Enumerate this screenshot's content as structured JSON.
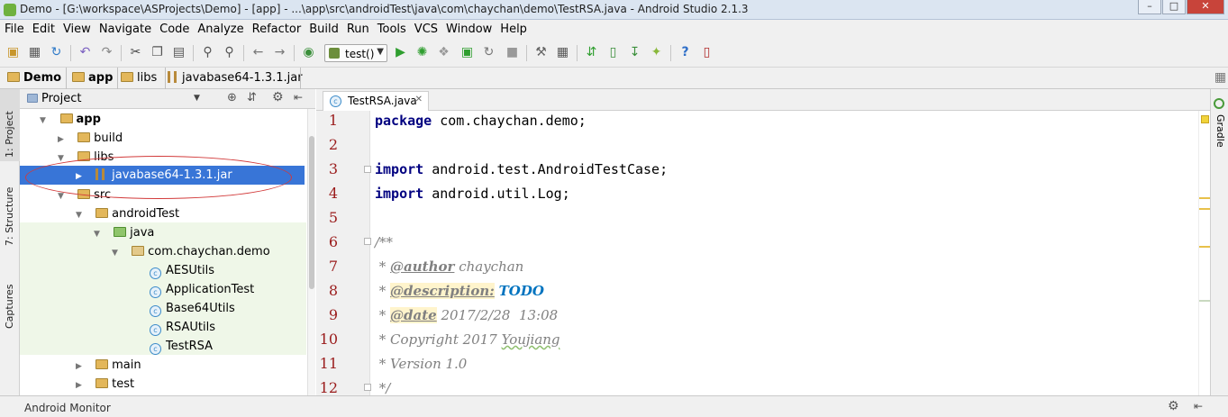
{
  "window": {
    "title": "Demo - [G:\\workspace\\ASProjects\\Demo] - [app] - ...\\app\\src\\androidTest\\java\\com\\chaychan\\demo\\TestRSA.java - Android Studio 2.1.3",
    "minimize": "–",
    "maximize": "□",
    "close": "✕"
  },
  "menu": [
    "File",
    "Edit",
    "View",
    "Navigate",
    "Code",
    "Analyze",
    "Refactor",
    "Build",
    "Run",
    "Tools",
    "VCS",
    "Window",
    "Help"
  ],
  "toolbar": {
    "run_config": "test()"
  },
  "breadcrumb": [
    "Demo",
    "app",
    "libs",
    "javabase64-1.3.1.jar"
  ],
  "left_stripe": {
    "project_tab": "1: Project",
    "structure_tab": "7: Structure",
    "captures_tab": "Captures"
  },
  "right_stripe": {
    "gradle_tab": "Gradle"
  },
  "project_panel": {
    "view": "Project",
    "tree": [
      {
        "label": "app",
        "indent": 0,
        "arrow": "▼"
      },
      {
        "label": "build",
        "indent": 1,
        "arrow": "▶"
      },
      {
        "label": "libs",
        "indent": 1,
        "arrow": "▼"
      },
      {
        "label": "javabase64-1.3.1.jar",
        "indent": 2,
        "arrow": "▶",
        "selected": true
      },
      {
        "label": "src",
        "indent": 1,
        "arrow": "▼"
      },
      {
        "label": "androidTest",
        "indent": 2,
        "arrow": "▼"
      },
      {
        "label": "java",
        "indent": 3,
        "arrow": "▼"
      },
      {
        "label": "com.chaychan.demo",
        "indent": 4,
        "arrow": "▼"
      },
      {
        "label": "AESUtils",
        "indent": 5,
        "arrow": ""
      },
      {
        "label": "ApplicationTest",
        "indent": 5,
        "arrow": ""
      },
      {
        "label": "Base64Utils",
        "indent": 5,
        "arrow": ""
      },
      {
        "label": "RSAUtils",
        "indent": 5,
        "arrow": ""
      },
      {
        "label": "TestRSA",
        "indent": 5,
        "arrow": ""
      },
      {
        "label": "main",
        "indent": 2,
        "arrow": "▶"
      },
      {
        "label": "test",
        "indent": 2,
        "arrow": "▶"
      }
    ]
  },
  "editor": {
    "tab": "TestRSA.java",
    "line_numbers": [
      "1",
      "2",
      "3",
      "4",
      "5",
      "6",
      "7",
      "8",
      "9",
      "10",
      "11",
      "12"
    ],
    "lines": {
      "l1_kw": "package",
      "l1_rest": " com.chaychan.demo;",
      "l3_kw": "import",
      "l3_rest": " android.test.AndroidTestCase;",
      "l4_kw": "import",
      "l4_rest": " android.util.Log;",
      "l6": "/**",
      "l7_star": " * ",
      "l7_tag": "@author",
      "l7_rest": " chaychan",
      "l8_star": " * ",
      "l8_tag": "@description:",
      "l8_todo": "TODO",
      "l9_star": " * ",
      "l9_tag": "@date",
      "l9_rest": " 2017/2/28  13:08",
      "l10_pre": " * Copyright 2017 ",
      "l10_word": "Youjiang",
      "l11": " * Version 1.0",
      "l12": " */"
    }
  },
  "bottom": {
    "label": "Android Monitor"
  },
  "colors": {
    "keyword": "#000080",
    "comment": "#808080",
    "todo": "#0073bf",
    "selection": "#3875d7",
    "test_bg": "#eff7e8",
    "annotation_ellipse": "#d23a3a"
  }
}
